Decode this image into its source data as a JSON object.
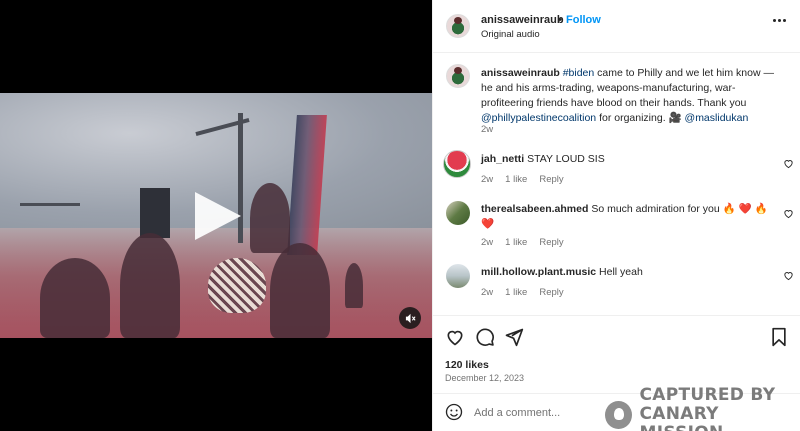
{
  "post": {
    "username": "anissaweinraub",
    "separator": "•",
    "follow_label": "Follow",
    "audio": "Original audio",
    "caption": {
      "user": "anissaweinraub",
      "hashtag": "#biden",
      "text1": " came to Philly and we let him know — he and his arms-trading, weapons-manufacturing, war-profiteering friends have blood on their hands. Thank you ",
      "mention1": "@phillypalestinecoalition",
      "text2": " for organizing. 🎥 ",
      "mention2": "@maslidukan",
      "time": "2w"
    },
    "likes": "120 likes",
    "date": "December 12, 2023",
    "add_comment_placeholder": "Add a comment..."
  },
  "comments": [
    {
      "user": "jah_netti",
      "text": "STAY LOUD SIS",
      "time": "2w",
      "likes": "1 like",
      "reply": "Reply"
    },
    {
      "user": "therealsabeen.ahmed",
      "text": "So much admiration for you 🔥 ❤️ 🔥 ❤️",
      "time": "2w",
      "likes": "1 like",
      "reply": "Reply"
    },
    {
      "user": "mill.hollow.plant.music",
      "text": "Hell yeah",
      "time": "2w",
      "likes": "1 like",
      "reply": "Reply"
    }
  ],
  "watermark": {
    "line1": "CAPTURED BY",
    "line2": "CANARY MISSION"
  },
  "icons": {
    "more": "more-options-icon",
    "like": "heart-icon",
    "comment": "comment-icon",
    "share": "send-icon",
    "save": "bookmark-icon",
    "emoji": "emoji-icon",
    "play": "play-icon",
    "mute": "mute-icon"
  },
  "colors": {
    "follow": "#0095f6",
    "link": "#00376b",
    "muted": "#737373"
  }
}
